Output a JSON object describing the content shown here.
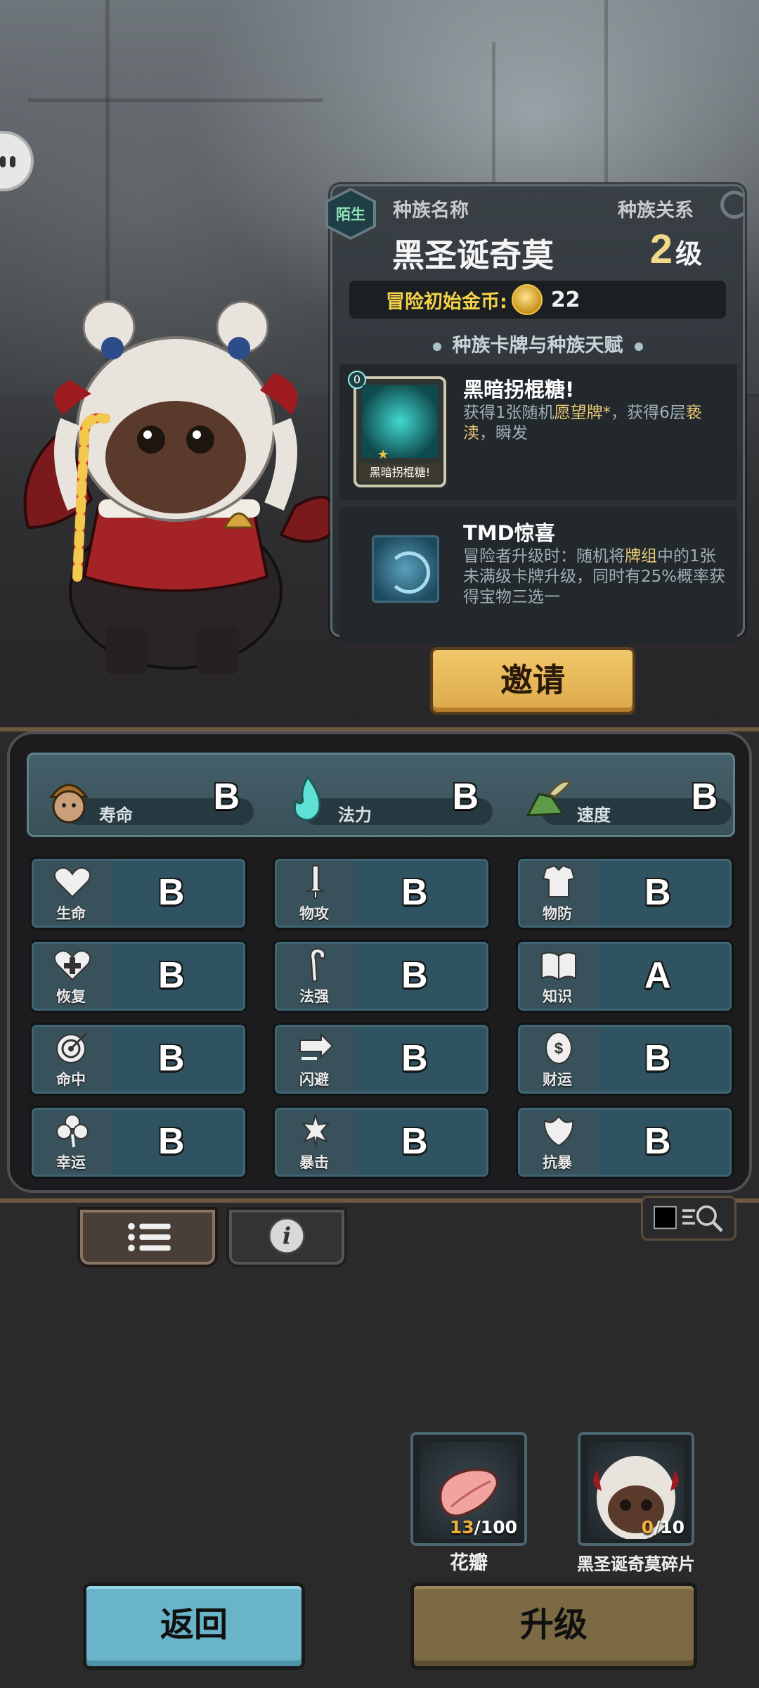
{
  "race_panel": {
    "relation_badge": "陌生",
    "race_name_label": "种族名称",
    "race_relation_label": "种族关系",
    "race_name": "黑圣诞奇莫",
    "level_number": "2",
    "level_unit": "级",
    "starting_gold_label": "冒险初始金币:",
    "starting_gold_value": "22",
    "section_title": "种族卡牌与种族天赋",
    "card": {
      "cost": "0",
      "thumb_caption": "黑暗拐棍糖!",
      "title": "黑暗拐棍糖!",
      "desc_1": "获得1张随机",
      "desc_hl_1": "愿望牌*",
      "desc_2": "，获得6层",
      "desc_hl_2": "亵渎",
      "desc_3": "，瞬发"
    },
    "talent": {
      "title": "TMD惊喜",
      "desc_1": "冒险者升级时：随机将",
      "desc_hl": "牌组",
      "desc_2": "中的1张未满级卡牌升级，同时有25%概率获得宝物三选一"
    },
    "invite_button": "邀请"
  },
  "top_stats": [
    {
      "name": "寿命",
      "grade": "B",
      "icon": "acorn-face-icon"
    },
    {
      "name": "法力",
      "grade": "B",
      "icon": "blue-flame-icon"
    },
    {
      "name": "速度",
      "grade": "B",
      "icon": "winged-boot-icon"
    }
  ],
  "stats": [
    {
      "name": "生命",
      "grade": "B",
      "icon": "heart-icon"
    },
    {
      "name": "物攻",
      "grade": "B",
      "icon": "sword-icon"
    },
    {
      "name": "物防",
      "grade": "B",
      "icon": "armor-icon"
    },
    {
      "name": "恢复",
      "grade": "B",
      "icon": "heart-plus-icon"
    },
    {
      "name": "法强",
      "grade": "B",
      "icon": "staff-icon"
    },
    {
      "name": "知识",
      "grade": "A",
      "icon": "book-icon"
    },
    {
      "name": "命中",
      "grade": "B",
      "icon": "target-icon"
    },
    {
      "name": "闪避",
      "grade": "B",
      "icon": "dodge-arrow-icon"
    },
    {
      "name": "财运",
      "grade": "B",
      "icon": "coin-icon"
    },
    {
      "name": "幸运",
      "grade": "B",
      "icon": "clover-icon"
    },
    {
      "name": "暴击",
      "grade": "B",
      "icon": "critical-icon"
    },
    {
      "name": "抗暴",
      "grade": "B",
      "icon": "shield-flower-icon"
    }
  ],
  "resources": [
    {
      "label": "花瓣",
      "current": "13",
      "total": "/100",
      "icon": "petal-icon"
    },
    {
      "label": "黑圣诞奇莫碎片",
      "current": "0",
      "total": "/10",
      "icon": "character-portrait-icon"
    }
  ],
  "buttons": {
    "back": "返回",
    "upgrade": "升级"
  },
  "tabs": [
    {
      "icon": "list-icon"
    },
    {
      "icon": "info-icon"
    }
  ]
}
